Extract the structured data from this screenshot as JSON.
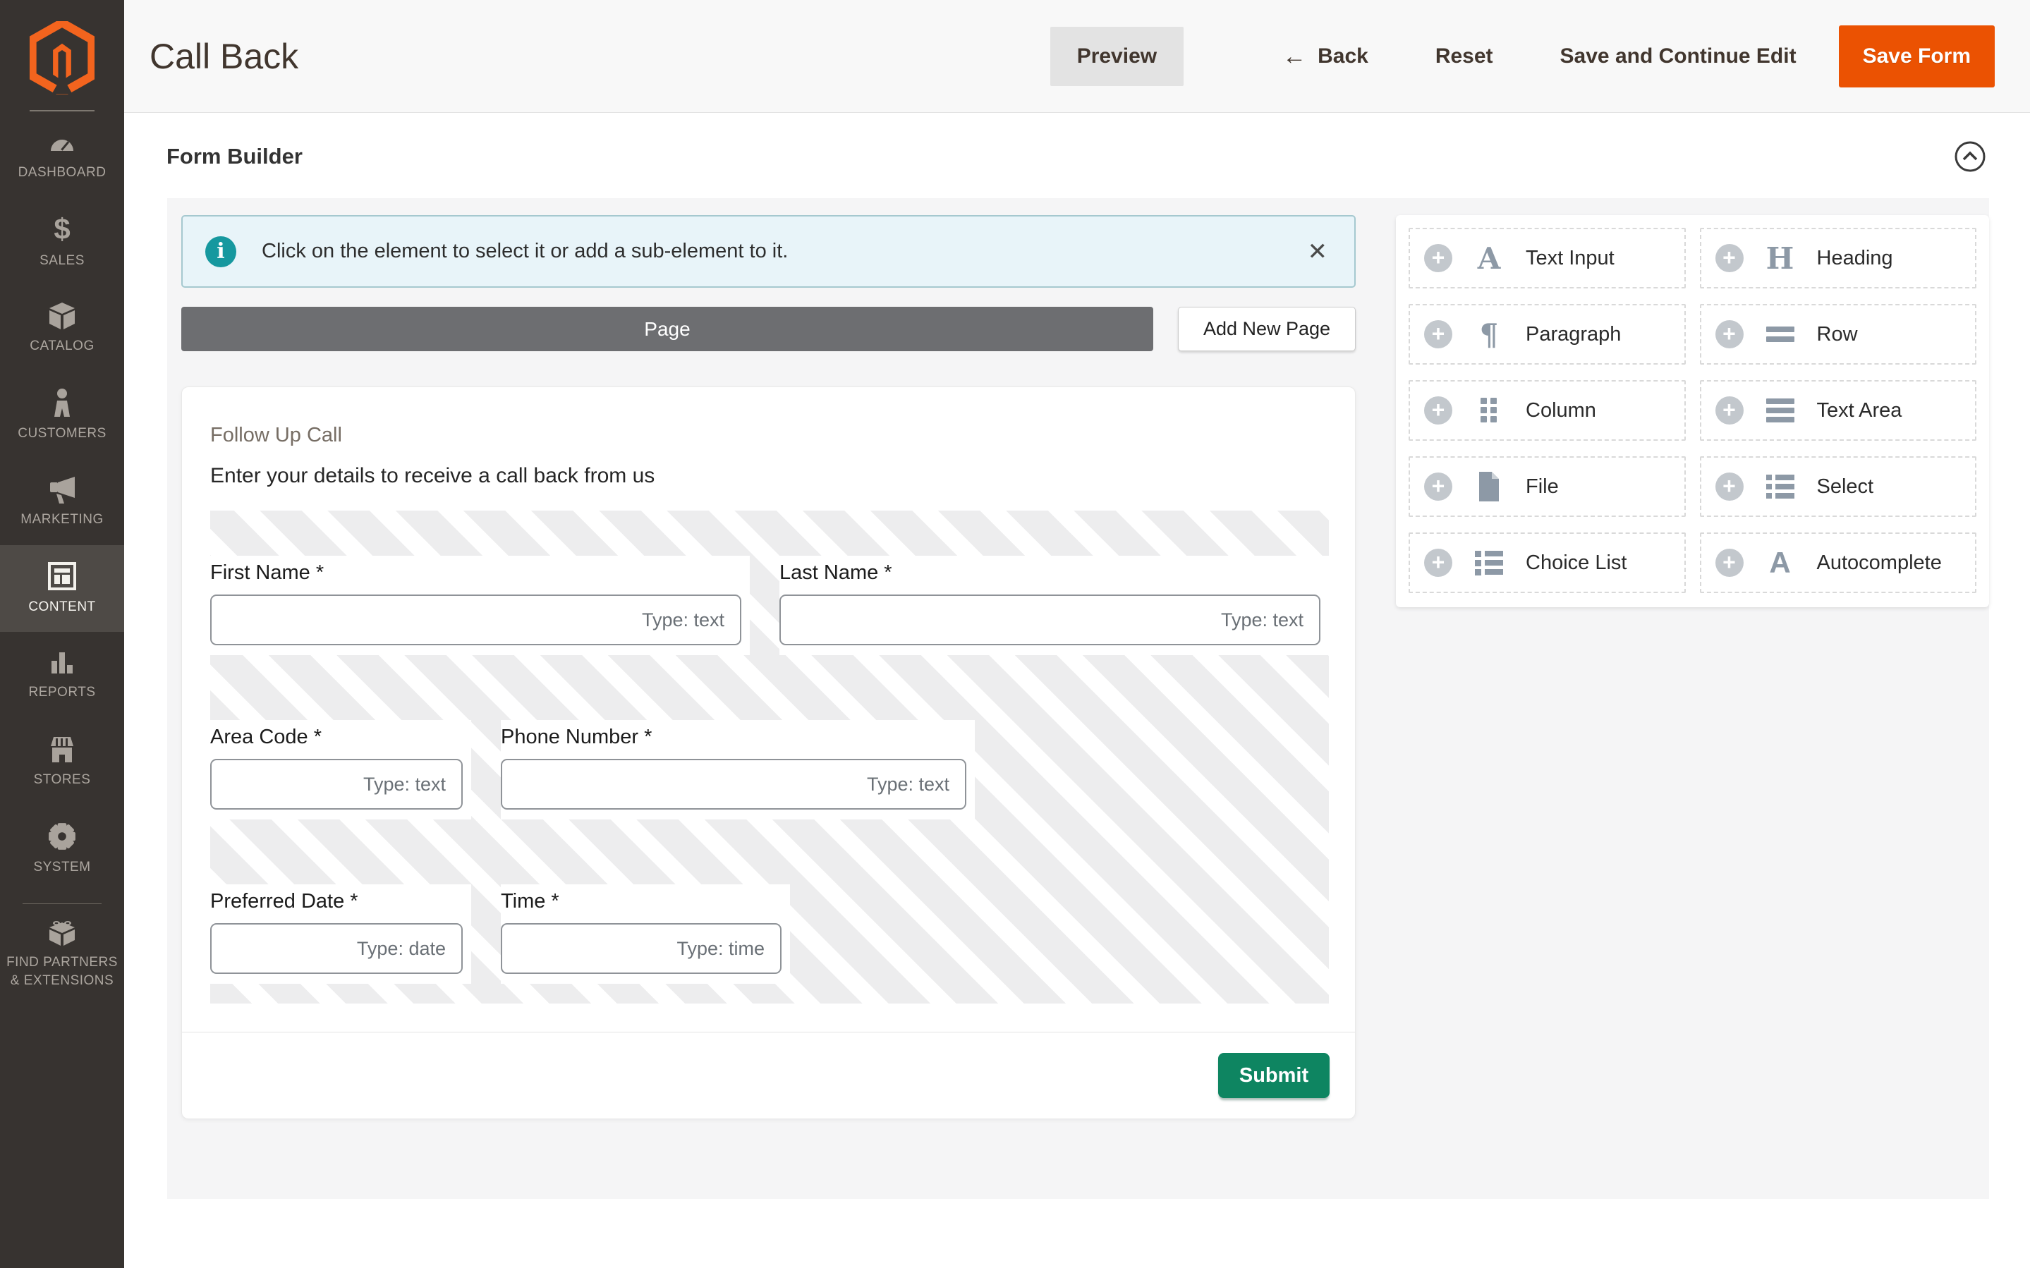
{
  "header": {
    "title": "Call Back",
    "buttons": {
      "preview": "Preview",
      "back": "Back",
      "back_arrow": "←",
      "reset": "Reset",
      "save_continue": "Save and Continue Edit",
      "save_form": "Save Form"
    }
  },
  "sidebar": {
    "items": [
      {
        "label": "DASHBOARD",
        "icon": "dashboard-icon",
        "active": false
      },
      {
        "label": "SALES",
        "icon": "sales-icon",
        "active": false
      },
      {
        "label": "CATALOG",
        "icon": "catalog-icon",
        "active": false
      },
      {
        "label": "CUSTOMERS",
        "icon": "customers-icon",
        "active": false
      },
      {
        "label": "MARKETING",
        "icon": "marketing-icon",
        "active": false
      },
      {
        "label": "CONTENT",
        "icon": "content-icon",
        "active": true
      },
      {
        "label": "REPORTS",
        "icon": "reports-icon",
        "active": false
      },
      {
        "label": "STORES",
        "icon": "stores-icon",
        "active": false
      },
      {
        "label": "SYSTEM",
        "icon": "system-icon",
        "active": false
      },
      {
        "label": "FIND PARTNERS & EXTENSIONS",
        "icon": "find-partners-icon",
        "active": false
      }
    ]
  },
  "panel": {
    "title": "Form Builder"
  },
  "builder": {
    "notice": "Click on the element to select it or add a sub-element to it.",
    "close_glyph": "✕",
    "page_tab": "Page",
    "add_new_page": "Add New Page"
  },
  "form": {
    "heading": "Follow Up Call",
    "description": "Enter your details to receive a call back from us",
    "rows": [
      {
        "fields": [
          {
            "label": "First Name *",
            "hint": "Type: text"
          },
          {
            "label": "Last Name *",
            "hint": "Type: text"
          }
        ]
      },
      {
        "fields": [
          {
            "label": "Area Code *",
            "hint": "Type: text"
          },
          {
            "label": "Phone Number *",
            "hint": "Type: text"
          }
        ]
      },
      {
        "fields": [
          {
            "label": "Preferred Date *",
            "hint": "Type: date"
          },
          {
            "label": "Time *",
            "hint": "Type: time"
          }
        ]
      }
    ],
    "submit": "Submit"
  },
  "palette": {
    "items": [
      {
        "label": "Text Input",
        "icon": "text-input-icon",
        "glyph": "A"
      },
      {
        "label": "Heading",
        "icon": "heading-icon",
        "glyph": "H"
      },
      {
        "label": "Paragraph",
        "icon": "paragraph-icon",
        "glyph": "¶"
      },
      {
        "label": "Row",
        "icon": "row-icon"
      },
      {
        "label": "Column",
        "icon": "column-icon"
      },
      {
        "label": "Text Area",
        "icon": "text-area-icon"
      },
      {
        "label": "File",
        "icon": "file-icon"
      },
      {
        "label": "Select",
        "icon": "select-icon"
      },
      {
        "label": "Choice List",
        "icon": "choice-list-icon"
      },
      {
        "label": "Autocomplete",
        "icon": "autocomplete-icon",
        "glyph": "A"
      }
    ]
  },
  "colors": {
    "accent_orange": "#eb5202",
    "submit_green": "#0e8561",
    "info_teal": "#16989f",
    "sidebar_bg": "#373330",
    "page_bar_gray": "#6d6e71"
  }
}
